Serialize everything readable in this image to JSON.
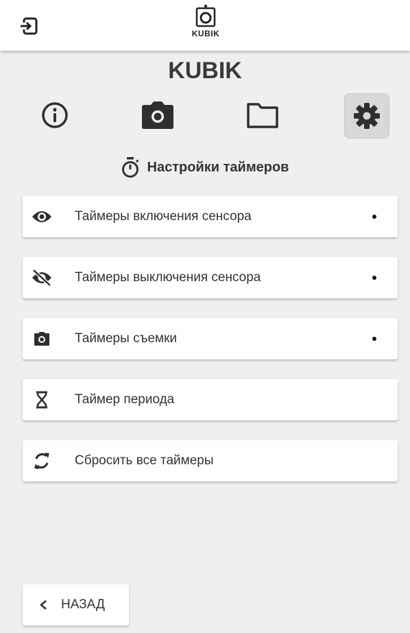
{
  "header": {
    "logo_text": "KUBIK",
    "exit_icon": "sign-in-icon"
  },
  "app_title": "KUBIK",
  "nav": [
    {
      "icon": "info-icon"
    },
    {
      "icon": "camera-icon"
    },
    {
      "icon": "folder-icon"
    },
    {
      "icon": "gear-icon",
      "active": true
    }
  ],
  "section": {
    "icon": "stopwatch-icon",
    "title": "Настройки таймеров"
  },
  "menu": [
    {
      "icon": "eye-icon",
      "label": "Таймеры включения сенсора",
      "dot": true
    },
    {
      "icon": "eye-slash-icon",
      "label": "Таймеры выключения сенсора",
      "dot": true
    },
    {
      "icon": "camera-icon",
      "label": "Таймеры съемки",
      "dot": true
    },
    {
      "icon": "hourglass-icon",
      "label": "Таймер периода",
      "dot": false
    },
    {
      "icon": "refresh-icon",
      "label": "Сбросить все таймеры",
      "dot": false
    }
  ],
  "back_button": {
    "label": "НАЗАД",
    "icon": "chevron-left-icon"
  },
  "colors": {
    "background": "#efefef",
    "header": "#ffffff",
    "active_tab": "#d8d8d8",
    "icon": "#2f2f2f"
  }
}
